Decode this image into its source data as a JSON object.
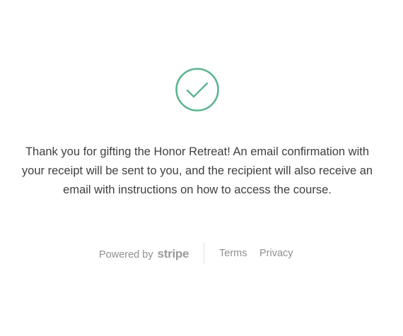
{
  "confirmation": {
    "icon": "checkmark-circle-icon",
    "accent_color": "#5bb58e",
    "message": "Thank you for gifting the Honor Retreat! An email confirmation with your receipt will be sent to you, and the recipient will also receive an email with instructions on how to access the course."
  },
  "footer": {
    "powered_by_label": "Powered by",
    "brand_name": "stripe",
    "terms_label": "Terms",
    "privacy_label": "Privacy"
  }
}
